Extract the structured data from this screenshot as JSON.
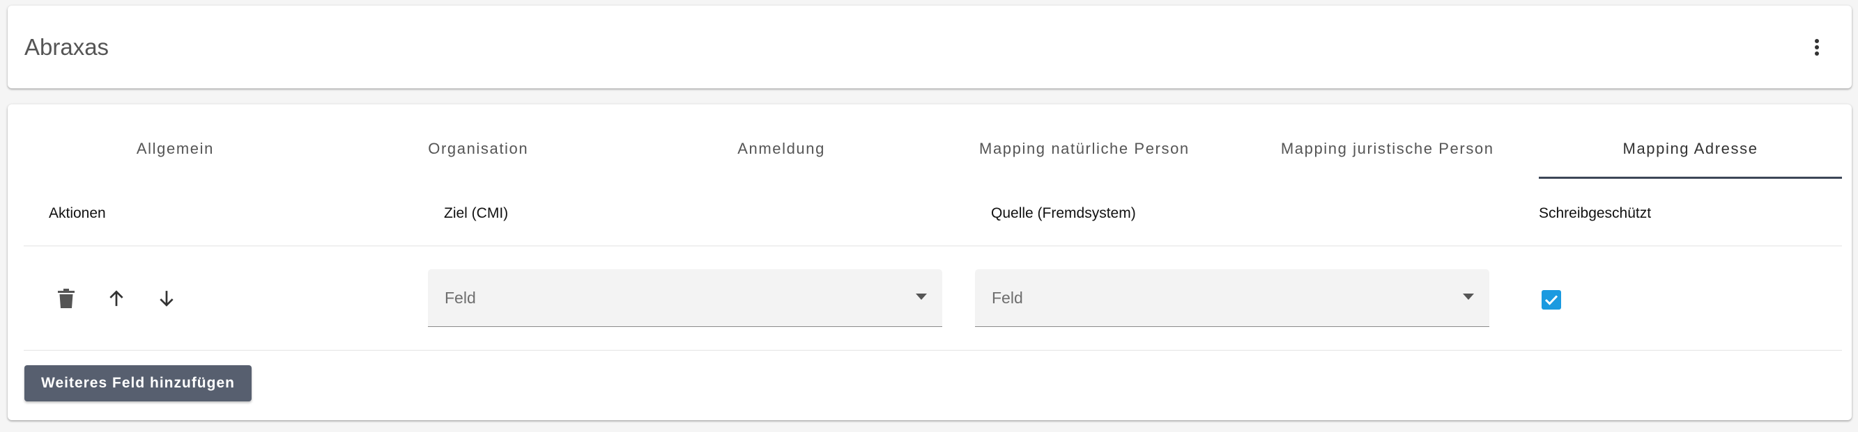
{
  "header": {
    "title": "Abraxas",
    "menu_icon": "more-vert-icon"
  },
  "tabs": [
    {
      "label": "Allgemein",
      "active": false
    },
    {
      "label": "Organisation",
      "active": false
    },
    {
      "label": "Anmeldung",
      "active": false
    },
    {
      "label": "Mapping natürliche Person",
      "active": false
    },
    {
      "label": "Mapping juristische Person",
      "active": false
    },
    {
      "label": "Mapping Adresse",
      "active": true
    }
  ],
  "table": {
    "columns": [
      "Aktionen",
      "Ziel (CMI)",
      "Quelle (Fremdsystem)",
      "Schreibgeschützt"
    ],
    "rows": [
      {
        "actions": [
          "delete-icon",
          "arrow-up-icon",
          "arrow-down-icon"
        ],
        "ziel": {
          "value": "",
          "placeholder": "Feld"
        },
        "quelle": {
          "value": "",
          "placeholder": "Feld"
        },
        "schreibgeschuetzt": true
      }
    ]
  },
  "add_button_label": "Weiteres Feld hinzufügen",
  "colors": {
    "tab_indicator": "#3c4657",
    "checkbox": "#1a9ae0",
    "add_button_bg": "#575f6f"
  }
}
